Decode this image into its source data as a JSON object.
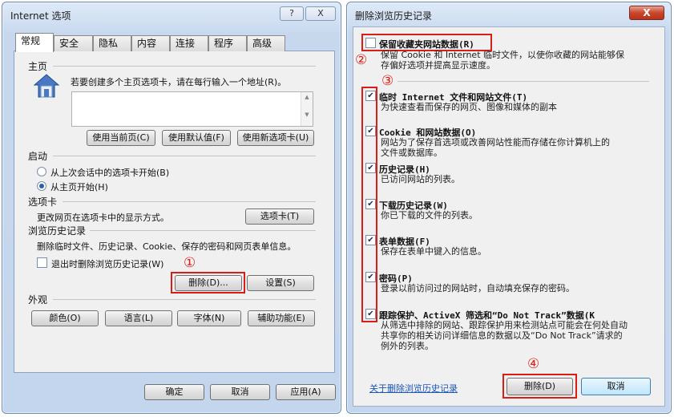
{
  "options_window": {
    "title": "Internet 选项",
    "help_btn": "?",
    "close_btn": "X",
    "tabs": [
      "常规",
      "安全",
      "隐私",
      "内容",
      "连接",
      "程序",
      "高级"
    ],
    "home": {
      "section": "主页",
      "hint": "若要创建多个主页选项卡，请在每行输入一个地址(R)。",
      "buttons": [
        "使用当前页(C)",
        "使用默认值(F)",
        "使用新选项卡(U)"
      ]
    },
    "startup": {
      "section": "启动",
      "options": [
        "从上次会话中的选项卡开始(B)",
        "从主页开始(H)"
      ]
    },
    "tabs_section": {
      "section": "选项卡",
      "desc": "更改网页在选项卡中的显示方式。",
      "button": "选项卡(T)"
    },
    "history": {
      "section": "浏览历史记录",
      "desc": "删除临时文件、历史记录、Cookie、保存的密码和网页表单信息。",
      "checkbox": "退出时删除浏览历史记录(W)",
      "delete_btn": "删除(D)...",
      "settings_btn": "设置(S)"
    },
    "appearance": {
      "section": "外观",
      "buttons": [
        "颜色(O)",
        "语言(L)",
        "字体(N)",
        "辅助功能(E)"
      ]
    },
    "footer": [
      "确定",
      "取消",
      "应用(A)"
    ]
  },
  "delete_window": {
    "title": "删除浏览历史记录",
    "close_btn": "X",
    "items": [
      {
        "title": "保留收藏夹网站数据(R)",
        "desc": [
          "保留 Cookie 和 Internet 临时文件，以使你收藏的网站能够保",
          "存偏好选项并提高显示速度。"
        ],
        "checked": false
      },
      {
        "title": "临时 Internet 文件和网站文件(T)",
        "desc": [
          "为快速查看而保存的网页、图像和媒体的副本"
        ],
        "checked": true
      },
      {
        "title": "Cookie 和网站数据(O)",
        "desc": [
          "网站为了保存首选项或改善网站性能而存储在你计算机上的",
          "文件或数据库。"
        ],
        "checked": true
      },
      {
        "title": "历史记录(H)",
        "desc": [
          "已访问网站的列表。"
        ],
        "checked": true
      },
      {
        "title": "下载历史记录(W)",
        "desc": [
          "你已下载的文件的列表。"
        ],
        "checked": true
      },
      {
        "title": "表单数据(F)",
        "desc": [
          "保存在表单中键入的信息。"
        ],
        "checked": true
      },
      {
        "title": "密码(P)",
        "desc": [
          "登录以前访问过的网站时，自动填充保存的密码。"
        ],
        "checked": true
      },
      {
        "title": "跟踪保护、ActiveX 筛选和“Do Not Track”数据(K",
        "desc": [
          "从筛选中排除的网站、跟踪保护用来检测站点可能会在何处自动",
          "共享你的相关访问详细信息的数据以及“Do Not Track”请求的",
          "例外的列表。"
        ],
        "checked": true
      }
    ],
    "link": "关于删除浏览历史记录",
    "delete_btn": "删除(D)",
    "cancel_btn": "取消"
  },
  "annotations": [
    "①",
    "②",
    "③",
    "④"
  ]
}
